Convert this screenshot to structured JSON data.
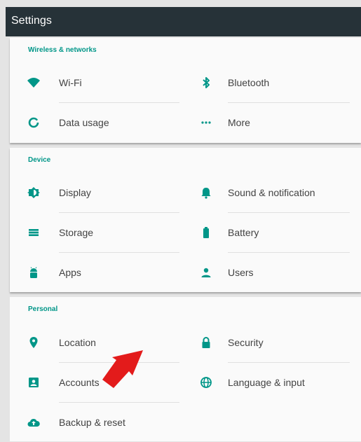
{
  "header": {
    "title": "Settings"
  },
  "sections": [
    {
      "heading": "Wireless & networks",
      "items": [
        {
          "label": "Wi-Fi",
          "icon": "wifi-icon"
        },
        {
          "label": "Bluetooth",
          "icon": "bluetooth-icon"
        },
        {
          "label": "Data usage",
          "icon": "data-usage-icon"
        },
        {
          "label": "More",
          "icon": "more-icon"
        }
      ]
    },
    {
      "heading": "Device",
      "items": [
        {
          "label": "Display",
          "icon": "brightness-icon"
        },
        {
          "label": "Sound & notification",
          "icon": "bell-icon"
        },
        {
          "label": "Storage",
          "icon": "storage-icon"
        },
        {
          "label": "Battery",
          "icon": "battery-icon"
        },
        {
          "label": "Apps",
          "icon": "android-icon"
        },
        {
          "label": "Users",
          "icon": "person-icon"
        }
      ]
    },
    {
      "heading": "Personal",
      "items": [
        {
          "label": "Location",
          "icon": "location-pin-icon"
        },
        {
          "label": "Security",
          "icon": "lock-icon"
        },
        {
          "label": "Accounts",
          "icon": "account-box-icon"
        },
        {
          "label": "Language & input",
          "icon": "globe-icon"
        },
        {
          "label": "Backup & reset",
          "icon": "cloud-upload-icon"
        }
      ]
    }
  ],
  "colors": {
    "accent": "#009688",
    "toolbar": "#263238",
    "annotation_arrow": "#e31b1b"
  }
}
